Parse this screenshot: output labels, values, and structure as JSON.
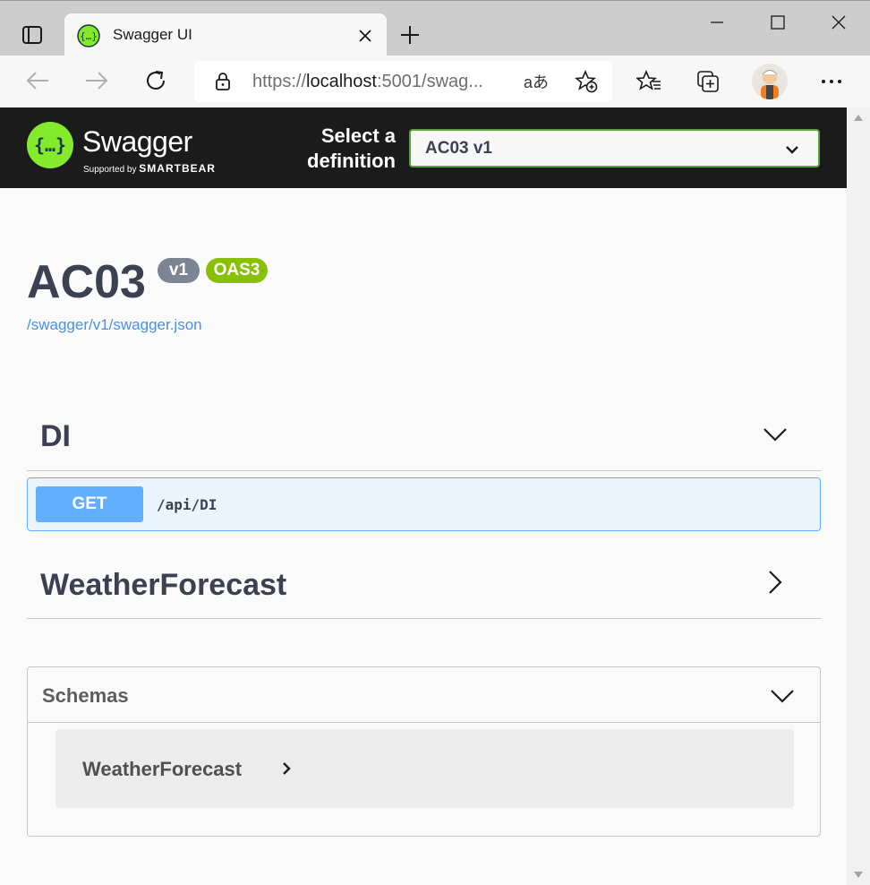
{
  "browser": {
    "tab_title": "Swagger UI",
    "url_prefix": "https://",
    "url_host": "localhost",
    "url_rest": ":5001/swag...",
    "read_aloud_label": "aあ"
  },
  "header": {
    "brand": "Swagger",
    "brand_sub_prefix": "Supported by",
    "brand_sub_company": "SMARTBEAR",
    "select_label": "Select a definition",
    "select_value": "AC03 v1"
  },
  "info": {
    "title": "AC03",
    "version_badge": "v1",
    "spec_badge": "OAS3",
    "spec_link": "/swagger/v1/swagger.json"
  },
  "tags": [
    {
      "name": "DI",
      "expanded": true
    },
    {
      "name": "WeatherForecast",
      "expanded": false
    }
  ],
  "operations": [
    {
      "method": "GET",
      "path": "/api/DI"
    }
  ],
  "schemas": {
    "title": "Schemas",
    "models": [
      "WeatherForecast"
    ]
  },
  "colors": {
    "header_bg": "#1b1b1b",
    "logo_green": "#85ea2d",
    "select_border": "#62a03f",
    "get_blue": "#61affe",
    "get_bg": "#ebf3fb",
    "version_badge": "#7d8492",
    "oas_badge": "#89bf04",
    "link": "#4990e2",
    "text": "#3b4151"
  },
  "icons": [
    "tab-actions-icon",
    "swagger-favicon",
    "close-icon",
    "new-tab-icon",
    "minimize-icon",
    "maximize-icon",
    "window-close-icon",
    "back-icon",
    "forward-icon",
    "refresh-icon",
    "lock-icon",
    "add-favorite-icon",
    "favorites-icon",
    "collections-icon",
    "more-icon",
    "chevron-down-icon",
    "chevron-right-icon"
  ]
}
